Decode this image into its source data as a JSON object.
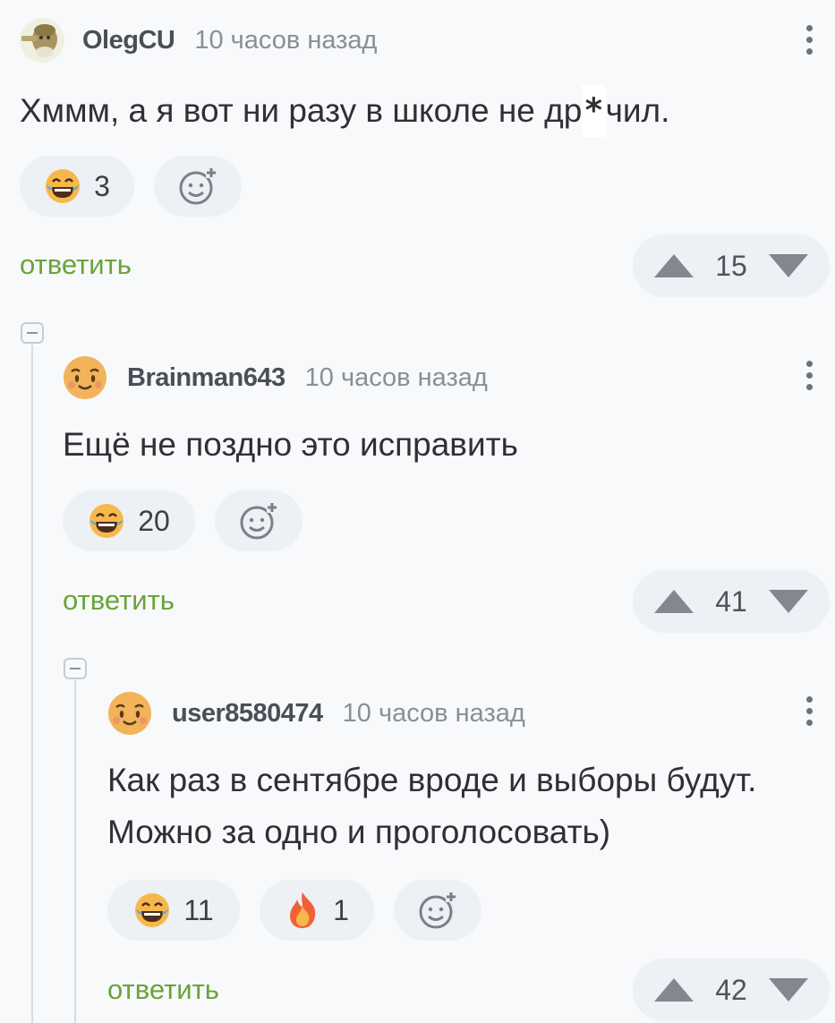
{
  "comments": [
    {
      "author": "OlegCU",
      "time": "10 часов назад",
      "text_before": "Хммм, а я вот ни разу в школе не др",
      "text_censor": "*",
      "text_after": "чил.",
      "reactions": [
        {
          "icon": "laughing-emoji-icon",
          "count": "3"
        }
      ],
      "reply_label": "ответить",
      "votes": "15"
    },
    {
      "author": "Brainman643",
      "time": "10 часов назад",
      "text": "Ещё не поздно это исправить",
      "reactions": [
        {
          "icon": "laughing-emoji-icon",
          "count": "20"
        }
      ],
      "reply_label": "ответить",
      "votes": "41"
    },
    {
      "author": "user8580474",
      "time": "10 часов назад",
      "text_line1": "Как раз в сентябре вроде и выборы будут.",
      "text_line2": "Можно за одно и проголосовать)",
      "reactions": [
        {
          "icon": "laughing-emoji-icon",
          "count": "11"
        },
        {
          "icon": "fire-emoji-icon",
          "count": "1"
        }
      ],
      "reply_label": "ответить",
      "votes": "42"
    }
  ],
  "colors": {
    "accent_green": "#6aa339",
    "background": "#f7f9fb",
    "pill": "#edf0f4"
  }
}
